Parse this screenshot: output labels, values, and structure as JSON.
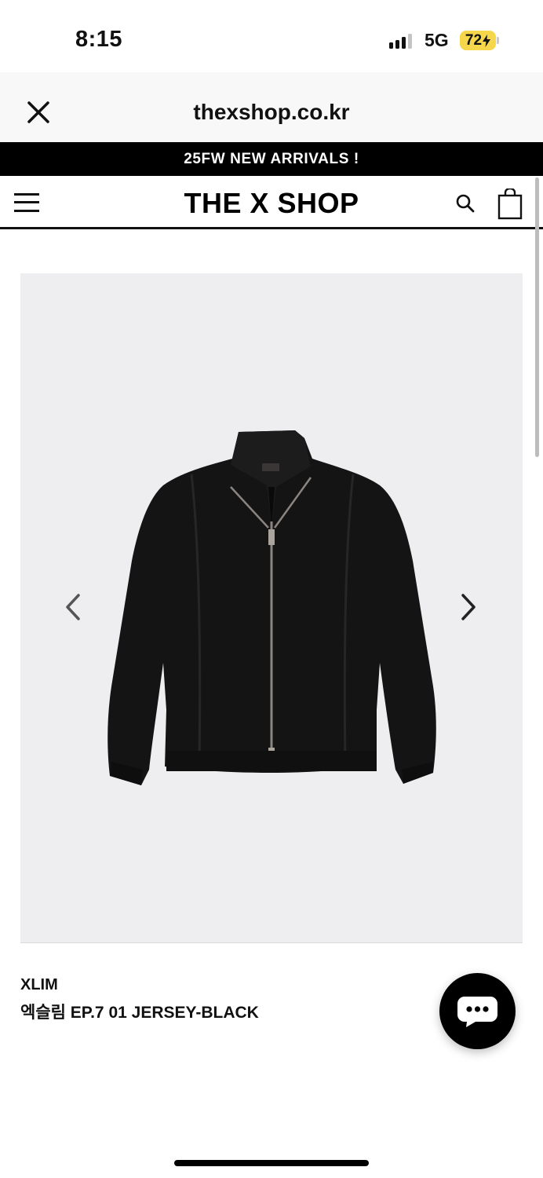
{
  "status_bar": {
    "time": "8:15",
    "network": "5G",
    "battery": "72"
  },
  "browser": {
    "url": "thexshop.co.kr",
    "close_icon": "close-icon"
  },
  "announcement": {
    "text": "25FW NEW ARRIVALS !"
  },
  "header": {
    "logo": "THE X SHOP",
    "menu_icon": "hamburger-menu-icon",
    "search_icon": "search-icon",
    "cart_icon": "shopping-bag-icon"
  },
  "product": {
    "brand": "XLIM",
    "name": "엑슬림 EP.7 01 JERSEY-BLACK",
    "image_subject": "black zip-up knit jersey jacket",
    "prev_icon": "chevron-left-icon",
    "next_icon": "chevron-right-icon",
    "image_background": "#eeeef1"
  },
  "chat": {
    "icon": "chat-bubble-icon"
  },
  "colors": {
    "accent": "#000000",
    "battery": "#f6d64a",
    "announcement_bg": "#000000",
    "announcement_text": "#ffffff"
  }
}
